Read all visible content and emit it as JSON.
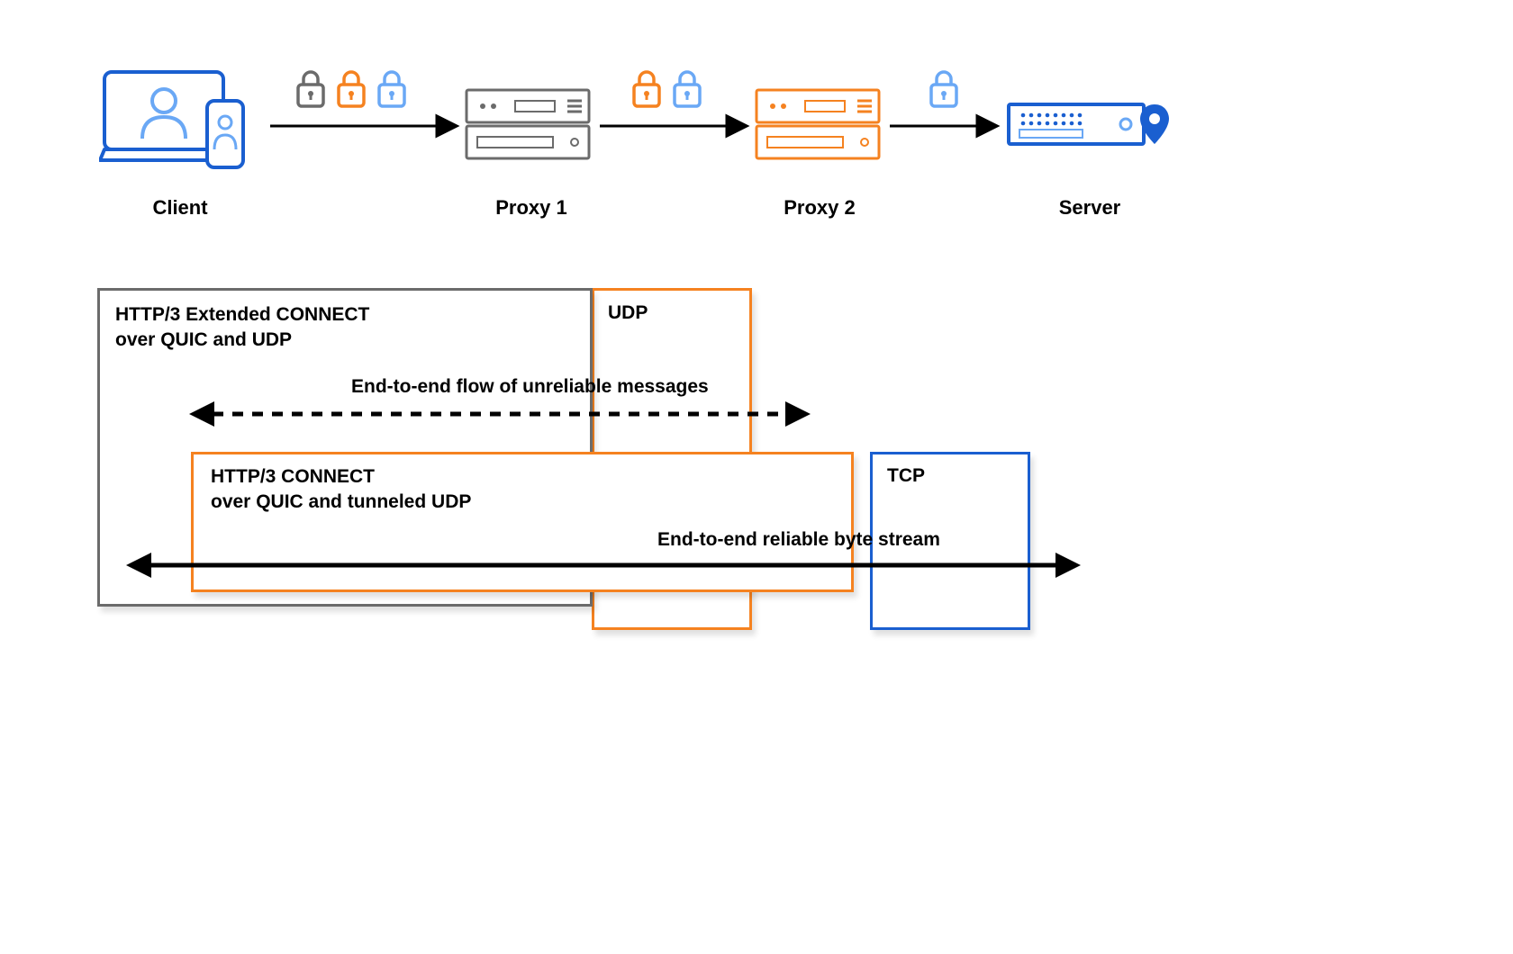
{
  "nodes": {
    "client": {
      "label": "Client"
    },
    "proxy1": {
      "label": "Proxy 1"
    },
    "proxy2": {
      "label": "Proxy 2"
    },
    "server": {
      "label": "Server"
    }
  },
  "hops": [
    {
      "from": "client",
      "to": "proxy1",
      "locks": [
        "gray",
        "orange",
        "blue"
      ]
    },
    {
      "from": "proxy1",
      "to": "proxy2",
      "locks": [
        "orange",
        "blue"
      ]
    },
    {
      "from": "proxy2",
      "to": "server",
      "locks": [
        "blue"
      ]
    }
  ],
  "protocol_boxes": {
    "outer_quic": {
      "title_l1": "HTTP/3 Extended CONNECT",
      "title_l2": "over QUIC and UDP"
    },
    "udp_box": {
      "title": "UDP"
    },
    "inner_quic": {
      "title_l1": "HTTP/3 CONNECT",
      "title_l2": "over QUIC and tunneled UDP"
    },
    "tcp_box": {
      "title": "TCP"
    }
  },
  "flows": {
    "unreliable": {
      "label": "End-to-end flow of unreliable messages"
    },
    "reliable": {
      "label": "End-to-end reliable byte stream"
    }
  },
  "colors": {
    "gray": "#6b6b6b",
    "orange": "#f58220",
    "blue": "#1a5fd0",
    "lightblue": "#6aa8f5",
    "black": "#000000"
  }
}
